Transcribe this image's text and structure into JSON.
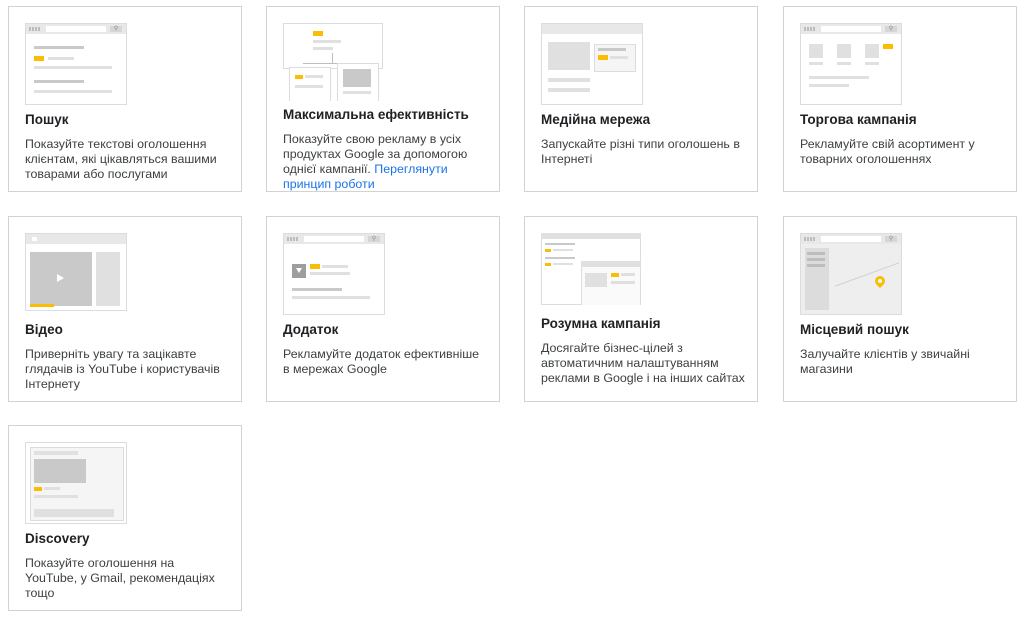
{
  "cards": [
    {
      "title": "Пошук",
      "desc": "Показуйте текстові оголошення клієнтам, які цікавляться вашими товарами або послугами",
      "link": ""
    },
    {
      "title": "Максимальна ефективність",
      "desc": "Показуйте свою рекламу в усіх продуктах Google за допомогою однієї кампанії.",
      "link": "Переглянути принцип роботи"
    },
    {
      "title": "Медійна мережа",
      "desc": "Запускайте різні типи оголошень в Інтернеті",
      "link": ""
    },
    {
      "title": "Торгова кампанія",
      "desc": "Рекламуйте свій асортимент у товарних оголошеннях",
      "link": ""
    },
    {
      "title": "Відео",
      "desc": "Приверніть увагу та зацікавте глядачів із YouTube і користувачів Інтернету",
      "link": ""
    },
    {
      "title": "Додаток",
      "desc": "Рекламуйте додаток ефективніше в мережах Google",
      "link": ""
    },
    {
      "title": "Розумна кампанія",
      "desc": "Досягайте бізнес-цілей з автоматичним налаштуванням реклами в Google і на інших сайтах",
      "link": ""
    },
    {
      "title": "Місцевий пошук",
      "desc": "Залучайте клієнтів у звичайні магазини",
      "link": ""
    },
    {
      "title": "Discovery",
      "desc": "Показуйте оголошення на YouTube, у Gmail, рекомендаціях тощо",
      "link": ""
    }
  ],
  "icons": {
    "search": "search-illustration-icon",
    "performance_max": "performance-max-illustration-icon",
    "display": "display-illustration-icon",
    "shopping": "shopping-illustration-icon",
    "video": "video-illustration-icon",
    "app": "app-illustration-icon",
    "smart": "smart-illustration-icon",
    "local": "local-illustration-icon",
    "discovery": "discovery-illustration-icon"
  },
  "colors": {
    "accent": "#fbbc04",
    "link": "#1a73e8",
    "border": "#d0d3d6"
  }
}
